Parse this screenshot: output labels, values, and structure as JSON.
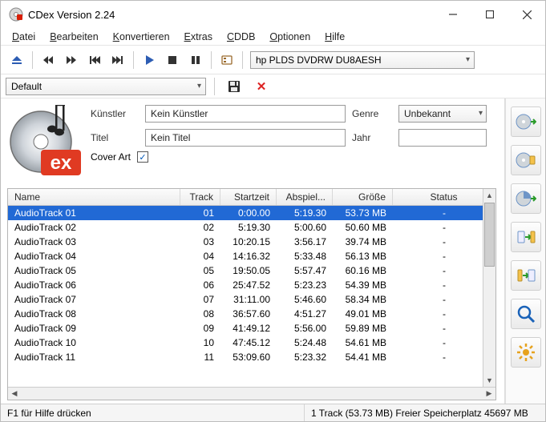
{
  "window": {
    "title": "CDex Version 2.24"
  },
  "menu": {
    "datei": {
      "label": "Datei",
      "ul": "D",
      "rest": "atei"
    },
    "bearbeiten": {
      "label": "Bearbeiten",
      "ul": "B",
      "rest": "earbeiten"
    },
    "konvertieren": {
      "label": "Konvertieren",
      "ul": "K",
      "rest": "onvertieren"
    },
    "extras": {
      "label": "Extras",
      "ul": "E",
      "rest": "xtras"
    },
    "cddb": {
      "label": "CDDB",
      "ul": "C",
      "rest": "DDB"
    },
    "optionen": {
      "label": "Optionen",
      "ul": "O",
      "rest": "ptionen"
    },
    "hilfe": {
      "label": "Hilfe",
      "ul": "H",
      "rest": "ilfe"
    }
  },
  "toolbar": {
    "drive": "hp PLDS DVDRW  DU8AESH"
  },
  "profile": {
    "name": "Default"
  },
  "cdinfo": {
    "artist_label": "Künstler",
    "artist": "Kein Künstler",
    "title_label": "Titel",
    "title": "Kein Titel",
    "genre_label": "Genre",
    "genre": "Unbekannt",
    "year_label": "Jahr",
    "year": "",
    "coverart_label": "Cover Art",
    "coverart_checked": true
  },
  "table": {
    "headers": {
      "name": "Name",
      "track": "Track",
      "start": "Startzeit",
      "play": "Abspiel...",
      "size": "Größe",
      "status": "Status"
    },
    "rows": [
      {
        "name": "AudioTrack 01",
        "track": "01",
        "start": "0:00.00",
        "play": "5:19.30",
        "size": "53.73 MB",
        "status": "-",
        "selected": true
      },
      {
        "name": "AudioTrack 02",
        "track": "02",
        "start": "5:19.30",
        "play": "5:00.60",
        "size": "50.60 MB",
        "status": "-"
      },
      {
        "name": "AudioTrack 03",
        "track": "03",
        "start": "10:20.15",
        "play": "3:56.17",
        "size": "39.74 MB",
        "status": "-"
      },
      {
        "name": "AudioTrack 04",
        "track": "04",
        "start": "14:16.32",
        "play": "5:33.48",
        "size": "56.13 MB",
        "status": "-"
      },
      {
        "name": "AudioTrack 05",
        "track": "05",
        "start": "19:50.05",
        "play": "5:57.47",
        "size": "60.16 MB",
        "status": "-"
      },
      {
        "name": "AudioTrack 06",
        "track": "06",
        "start": "25:47.52",
        "play": "5:23.23",
        "size": "54.39 MB",
        "status": "-"
      },
      {
        "name": "AudioTrack 07",
        "track": "07",
        "start": "31:11.00",
        "play": "5:46.60",
        "size": "58.34 MB",
        "status": "-"
      },
      {
        "name": "AudioTrack 08",
        "track": "08",
        "start": "36:57.60",
        "play": "4:51.27",
        "size": "49.01 MB",
        "status": "-"
      },
      {
        "name": "AudioTrack 09",
        "track": "09",
        "start": "41:49.12",
        "play": "5:56.00",
        "size": "59.89 MB",
        "status": "-"
      },
      {
        "name": "AudioTrack 10",
        "track": "10",
        "start": "47:45.12",
        "play": "5:24.48",
        "size": "54.61 MB",
        "status": "-"
      },
      {
        "name": "AudioTrack 11",
        "track": "11",
        "start": "53:09.60",
        "play": "5:23.32",
        "size": "54.41 MB",
        "status": "-"
      }
    ]
  },
  "status": {
    "help": "F1 für Hilfe drücken",
    "selection": "1 Track (53.73 MB) Freier Speicherplatz 45697 MB"
  }
}
